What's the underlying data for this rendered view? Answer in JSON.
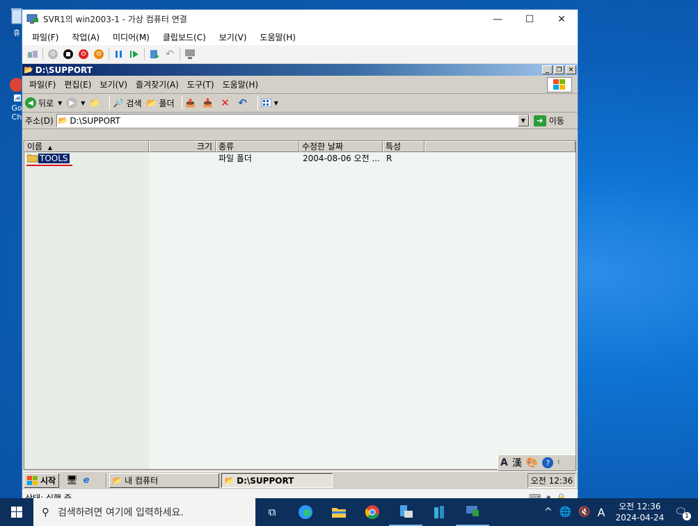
{
  "desktop": {
    "icon_labels": [
      "휴",
      "Go",
      "Ch"
    ]
  },
  "vm_window": {
    "title": "SVR1의 win2003-1 - 가상 컴퓨터 연결",
    "menu": [
      "파일(F)",
      "작업(A)",
      "미디어(M)",
      "클립보드(C)",
      "보기(V)",
      "도움말(H)"
    ],
    "status_text": "상태: 실행 중"
  },
  "explorer": {
    "title": "D:\\SUPPORT",
    "menu": [
      "파일(F)",
      "편집(E)",
      "보기(V)",
      "즐겨찾기(A)",
      "도구(T)",
      "도움말(H)"
    ],
    "toolbar": {
      "back": "뒤로",
      "search": "검색",
      "folders": "폴더"
    },
    "address_label": "주소(D)",
    "address_value": "D:\\SUPPORT",
    "go_label": "이동",
    "columns": [
      "이름",
      "크기",
      "종류",
      "수정한 날짜",
      "특성"
    ],
    "rows": [
      {
        "name": "TOOLS",
        "size": "",
        "type": "파일 폴더",
        "modified": "2004-08-06 오전 ...",
        "attr": "R"
      }
    ]
  },
  "guest_taskbar": {
    "start": "시작",
    "items": [
      "내 컴퓨터",
      "D:\\SUPPORT"
    ],
    "clock": "오전 12:36"
  },
  "ime": {
    "a": "A",
    "han": "漢"
  },
  "win_taskbar": {
    "search_placeholder": "검색하려면 여기에 입력하세요.",
    "time": "오전 12:36",
    "date": "2024-04-24",
    "ime_mode": "A",
    "notification_count": "1"
  }
}
